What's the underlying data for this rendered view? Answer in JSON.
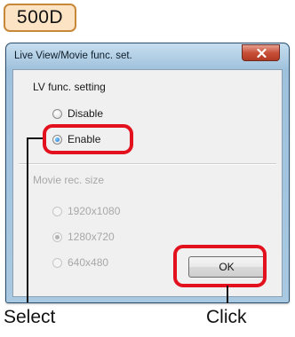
{
  "model_badge": "500D",
  "window": {
    "title": "Live View/Movie func. set."
  },
  "lv_group": {
    "heading": "LV func. setting",
    "options": [
      {
        "label": "Disable",
        "checked": false
      },
      {
        "label": "Enable",
        "checked": true
      }
    ]
  },
  "movie_group": {
    "heading": "Movie rec. size",
    "enabled": false,
    "options": [
      {
        "label": "1920x1080",
        "checked": false
      },
      {
        "label": "1280x720",
        "checked": true
      },
      {
        "label": "640x480",
        "checked": false
      }
    ]
  },
  "ok_button": "OK",
  "annotations": {
    "select": "Select",
    "click": "Click",
    "highlight_color": "#e3101d"
  },
  "colors": {
    "badge_fill": "#fbe3c4",
    "badge_border": "#c8883a",
    "close_button": "#c8503a"
  }
}
